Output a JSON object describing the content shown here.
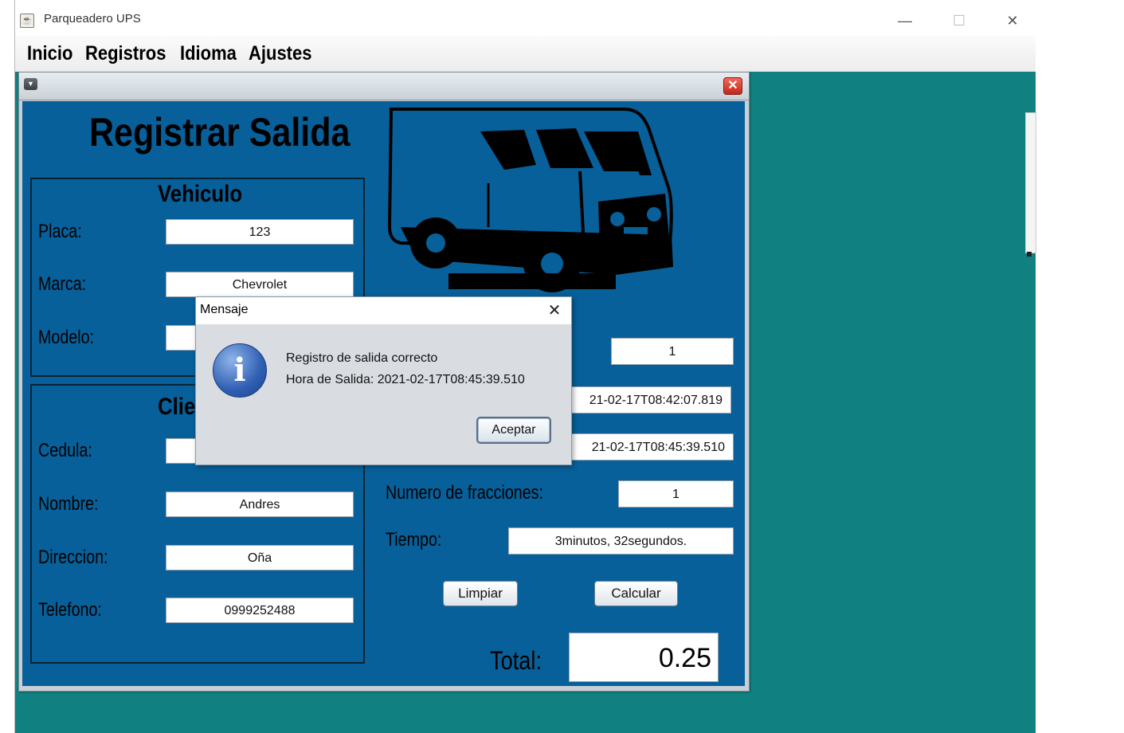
{
  "window": {
    "title": "Parqueadero UPS",
    "controls": {
      "minimize": "—",
      "maximize": "☐",
      "close": "✕"
    }
  },
  "menubar": {
    "items": [
      "Inicio",
      "Registros",
      "Idioma",
      "Ajustes"
    ]
  },
  "form": {
    "title": "Registrar Salida",
    "vehiculo": {
      "title": "Vehiculo",
      "placa_label": "Placa:",
      "placa_value": "123",
      "marca_label": "Marca:",
      "marca_value": "Chevrolet",
      "modelo_label": "Modelo:",
      "modelo_value": ""
    },
    "cliente": {
      "title": "Clie",
      "cedula_label": "Cedula:",
      "cedula_value": "",
      "nombre_label": "Nombre:",
      "nombre_value": "Andres",
      "direccion_label": "Direccion:",
      "direccion_value": "Oña",
      "telefono_label": "Telefono:",
      "telefono_value": "0999252488"
    },
    "right": {
      "field1_value": "1",
      "entrada_value": "21-02-17T08:42:07.819",
      "salida_value": "21-02-17T08:45:39.510",
      "fracciones_label": "Numero de fracciones:",
      "fracciones_value": "1",
      "tiempo_label": "Tiempo:",
      "tiempo_value": "3minutos, 32segundos."
    },
    "buttons": {
      "limpiar": "Limpiar",
      "calcular": "Calcular"
    },
    "total_label": "Total:",
    "total_value": "0.25"
  },
  "dialog": {
    "title": "Mensaje",
    "close": "✕",
    "icon_glyph": "i",
    "message_line1": "Registro de salida correcto",
    "message_line2": "Hora de Salida: 2021-02-17T08:45:39.510",
    "accept": "Aceptar"
  },
  "icons": {
    "app": "java-cup-icon",
    "info": "info-icon",
    "van": "delivery-van-illustration"
  },
  "colors": {
    "desktop": "#118080",
    "panel": "#07609a",
    "dialog": "#d9dde2"
  }
}
